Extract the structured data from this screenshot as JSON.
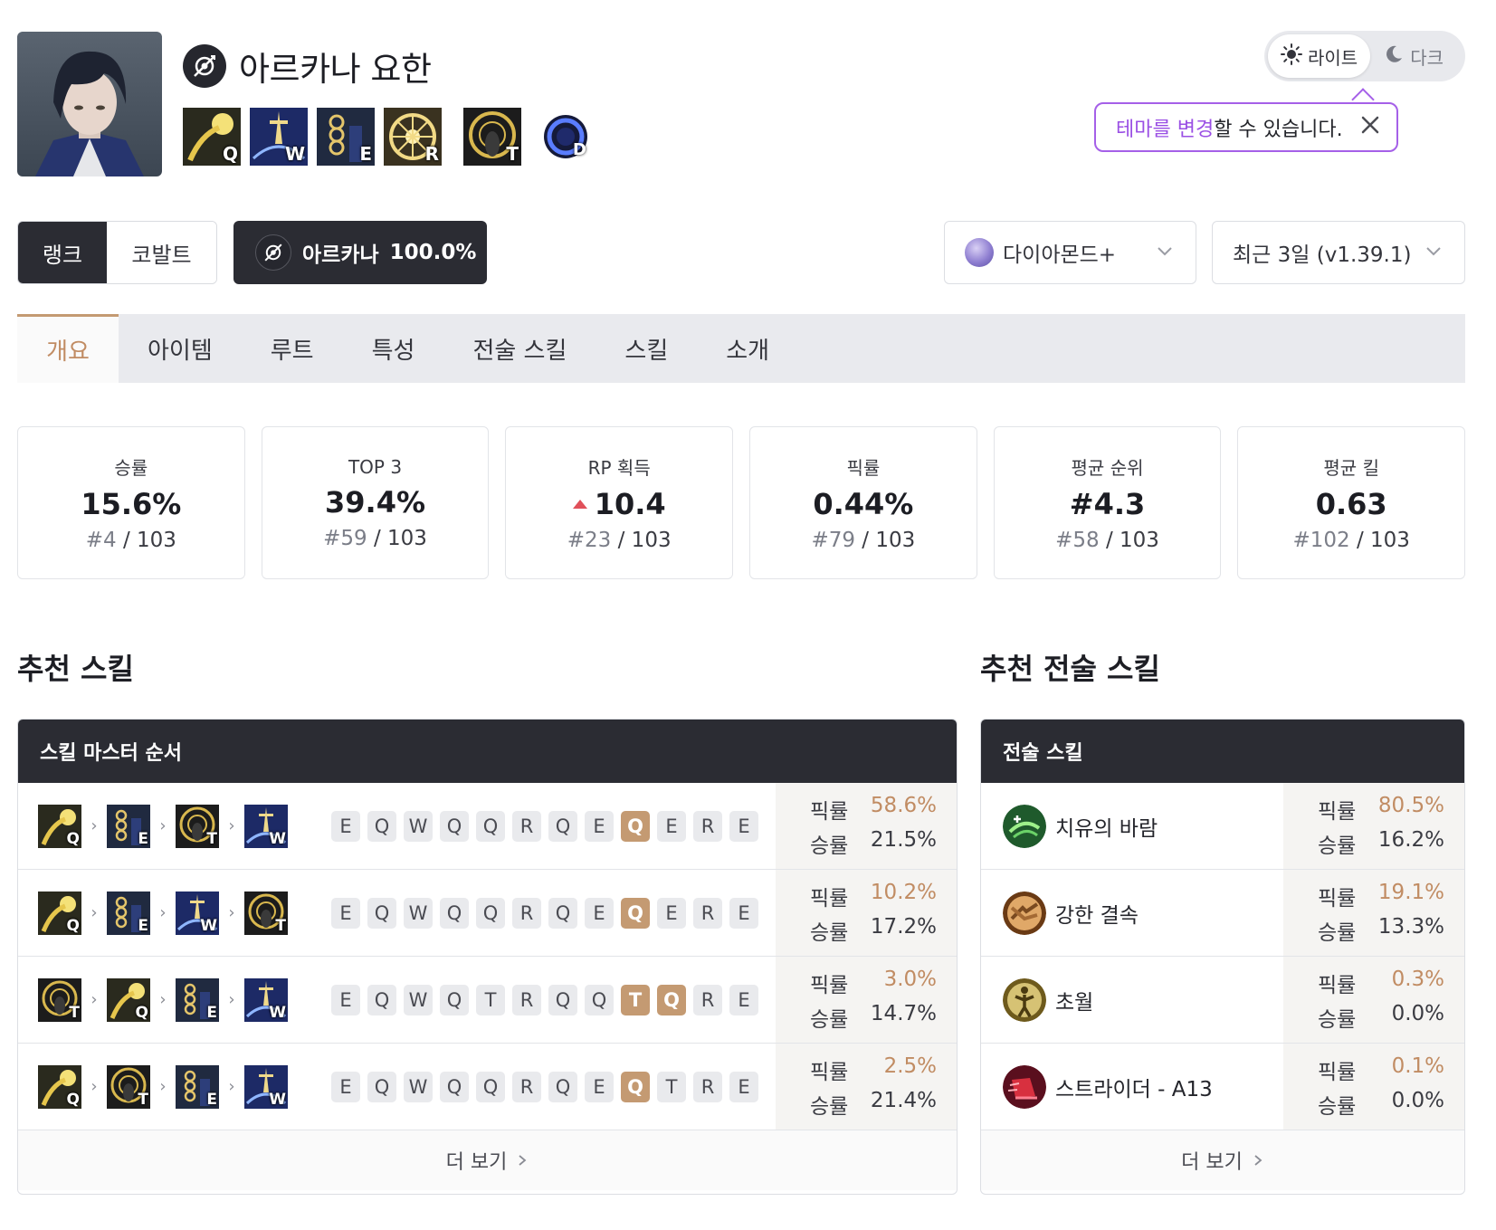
{
  "character": {
    "name": "아르카나 요한",
    "skills": [
      {
        "key": "Q",
        "icon": "bright-orb-skill-icon"
      },
      {
        "key": "W",
        "icon": "sword-rain-skill-icon"
      },
      {
        "key": "E",
        "icon": "chain-skill-icon"
      },
      {
        "key": "R",
        "icon": "radiant-wheel-skill-icon"
      },
      {
        "key": "T",
        "icon": "halo-skill-icon"
      },
      {
        "key": "D",
        "icon": "weapon-skill-icon"
      }
    ]
  },
  "theme": {
    "light_label": "라이트",
    "dark_label": "다크",
    "tooltip_highlight": "테마를 변경",
    "tooltip_rest": "할 수 있습니다."
  },
  "filters": {
    "mode_rank": "랭크",
    "mode_cobalt": "코발트",
    "arcana_label": "아르카나",
    "arcana_value": "100.0%",
    "tier": "다이아몬드+",
    "period": "최근 3일 (v1.39.1)"
  },
  "tabs": [
    "개요",
    "아이템",
    "루트",
    "특성",
    "전술 스킬",
    "스킬",
    "소개"
  ],
  "stats": [
    {
      "label": "승률",
      "value": "15.6%",
      "rank": "#4",
      "total": "/ 103",
      "trend": ""
    },
    {
      "label": "TOP 3",
      "value": "39.4%",
      "rank": "#59",
      "total": "/ 103",
      "trend": ""
    },
    {
      "label": "RP 획득",
      "value": "10.4",
      "rank": "#23",
      "total": "/ 103",
      "trend": "up"
    },
    {
      "label": "픽률",
      "value": "0.44%",
      "rank": "#79",
      "total": "/ 103",
      "trend": ""
    },
    {
      "label": "평균 순위",
      "value": "#4.3",
      "rank": "#58",
      "total": "/ 103",
      "trend": ""
    },
    {
      "label": "평균 킬",
      "value": "0.63",
      "rank": "#102",
      "total": "/ 103",
      "trend": ""
    }
  ],
  "skill_section": {
    "title": "추천 스킬",
    "panel_title": "스킬 마스터 순서",
    "pick_label": "픽률",
    "win_label": "승률",
    "more_label": "더 보기",
    "rows": [
      {
        "sequence": [
          "Q",
          "E",
          "T",
          "W"
        ],
        "order": [
          "E",
          "Q",
          "W",
          "Q",
          "Q",
          "R",
          "Q",
          "E",
          "Q",
          "E",
          "R",
          "E"
        ],
        "highlight": [
          8
        ],
        "pick": "58.6%",
        "win": "21.5%"
      },
      {
        "sequence": [
          "Q",
          "E",
          "W",
          "T"
        ],
        "order": [
          "E",
          "Q",
          "W",
          "Q",
          "Q",
          "R",
          "Q",
          "E",
          "Q",
          "E",
          "R",
          "E"
        ],
        "highlight": [
          8
        ],
        "pick": "10.2%",
        "win": "17.2%"
      },
      {
        "sequence": [
          "T",
          "Q",
          "E",
          "W"
        ],
        "order": [
          "E",
          "Q",
          "W",
          "Q",
          "T",
          "R",
          "Q",
          "Q",
          "T",
          "Q",
          "R",
          "E"
        ],
        "highlight": [
          8,
          9
        ],
        "pick": "3.0%",
        "win": "14.7%"
      },
      {
        "sequence": [
          "Q",
          "T",
          "E",
          "W"
        ],
        "order": [
          "E",
          "Q",
          "W",
          "Q",
          "Q",
          "R",
          "Q",
          "E",
          "Q",
          "T",
          "R",
          "E"
        ],
        "highlight": [
          8
        ],
        "pick": "2.5%",
        "win": "21.4%"
      }
    ]
  },
  "tactical_section": {
    "title": "추천 전술 스킬",
    "panel_title": "전술 스킬",
    "pick_label": "픽률",
    "win_label": "승률",
    "more_label": "더 보기",
    "rows": [
      {
        "name": "치유의 바람",
        "icon": "healing-wind-icon",
        "pick": "80.5%",
        "win": "16.2%"
      },
      {
        "name": "강한 결속",
        "icon": "strong-bond-icon",
        "pick": "19.1%",
        "win": "13.3%"
      },
      {
        "name": "초월",
        "icon": "transcendence-icon",
        "pick": "0.3%",
        "win": "0.0%"
      },
      {
        "name": "스트라이더 - A13",
        "icon": "strider-icon",
        "pick": "0.1%",
        "win": "0.0%"
      }
    ]
  },
  "colors": {
    "accent": "#c49a72",
    "dark_panel": "#2b2c33",
    "tooltip_border": "#a560e8",
    "trend_up": "#e0505a"
  }
}
